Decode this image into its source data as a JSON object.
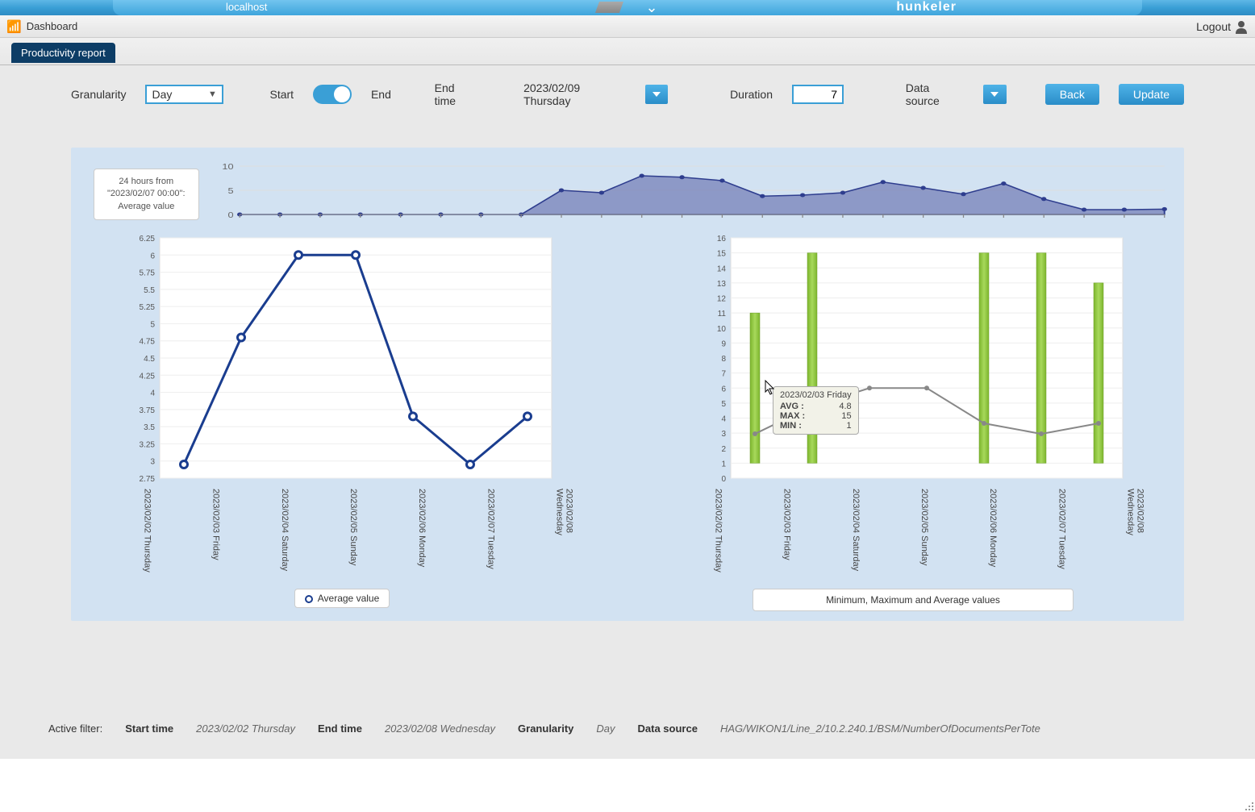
{
  "top": {
    "host": "localhost",
    "brand": "hunkeler"
  },
  "nav": {
    "dashboard": "Dashboard",
    "logout": "Logout"
  },
  "tab": {
    "productivity": "Productivity report"
  },
  "controls": {
    "granularity_label": "Granularity",
    "granularity_value": "Day",
    "start_label": "Start",
    "end_label": "End",
    "endtime_label": "End time",
    "endtime_value": "2023/02/09 Thursday",
    "duration_label": "Duration",
    "duration_value": "7",
    "datasource_label": "Data source",
    "back": "Back",
    "update": "Update"
  },
  "info": {
    "line1": "24 hours from",
    "line2": "\"2023/02/07 00:00\":",
    "line3": "Average value"
  },
  "legend_left": "Average value",
  "legend_right": "Minimum, Maximum and Average values",
  "tooltip": {
    "title": "2023/02/03 Friday",
    "avg_l": "AVG :",
    "avg_v": "4.8",
    "max_l": "MAX :",
    "max_v": "15",
    "min_l": "MIN :",
    "min_v": "1"
  },
  "footer": {
    "active_filter": "Active filter:",
    "start_l": "Start time",
    "start_v": "2023/02/02 Thursday",
    "end_l": "End time",
    "end_v": "2023/02/08 Wednesday",
    "gran_l": "Granularity",
    "gran_v": "Day",
    "ds_l": "Data source",
    "ds_v": "HAG/WIKON1/Line_2/10.2.240.1/BSM/NumberOfDocumentsPerTote"
  },
  "chart_data": [
    {
      "type": "area",
      "name": "timeline_24h",
      "title": "24 hours from 2023/02/07 00:00: Average value",
      "x": [
        0,
        1,
        2,
        3,
        4,
        5,
        6,
        7,
        8,
        9,
        10,
        11,
        12,
        13,
        14,
        15,
        16,
        17,
        18,
        19,
        20,
        21,
        22,
        23
      ],
      "values": [
        0,
        0,
        0,
        0,
        0,
        0,
        0,
        0,
        5,
        4.5,
        8,
        7.7,
        7,
        3.8,
        4,
        4.5,
        6.7,
        5.5,
        4.2,
        6.4,
        3.2,
        1,
        1,
        1.1
      ],
      "ylim": [
        0,
        10
      ],
      "ylabel": "",
      "xlabel": ""
    },
    {
      "type": "line",
      "name": "average_by_day",
      "categories": [
        "2023/02/02 Thursday",
        "2023/02/03 Friday",
        "2023/02/04 Saturday",
        "2023/02/05 Sunday",
        "2023/02/06 Monday",
        "2023/02/07 Tuesday",
        "2023/02/08 Wednesday"
      ],
      "values": [
        2.95,
        4.8,
        6,
        6,
        3.65,
        2.95,
        3.65
      ],
      "ylim": [
        2.75,
        6.25
      ],
      "ystep": 0.25,
      "legend": "Average value"
    },
    {
      "type": "bar",
      "name": "min_max_avg_by_day",
      "categories": [
        "2023/02/02 Thursday",
        "2023/02/03 Friday",
        "2023/02/04 Saturday",
        "2023/02/05 Sunday",
        "2023/02/06 Monday",
        "2023/02/07 Tuesday",
        "2023/02/08 Wednesday"
      ],
      "series": [
        {
          "name": "MAX",
          "values": [
            11,
            15,
            0,
            0,
            15,
            15,
            13
          ]
        },
        {
          "name": "MIN",
          "values": [
            1,
            1,
            0,
            0,
            1,
            1,
            1
          ]
        },
        {
          "name": "AVG",
          "values": [
            2.95,
            4.8,
            6,
            6,
            3.65,
            2.95,
            3.65
          ]
        }
      ],
      "ylim": [
        0,
        16
      ],
      "ystep": 1,
      "legend": "Minimum, Maximum and Average values"
    }
  ]
}
